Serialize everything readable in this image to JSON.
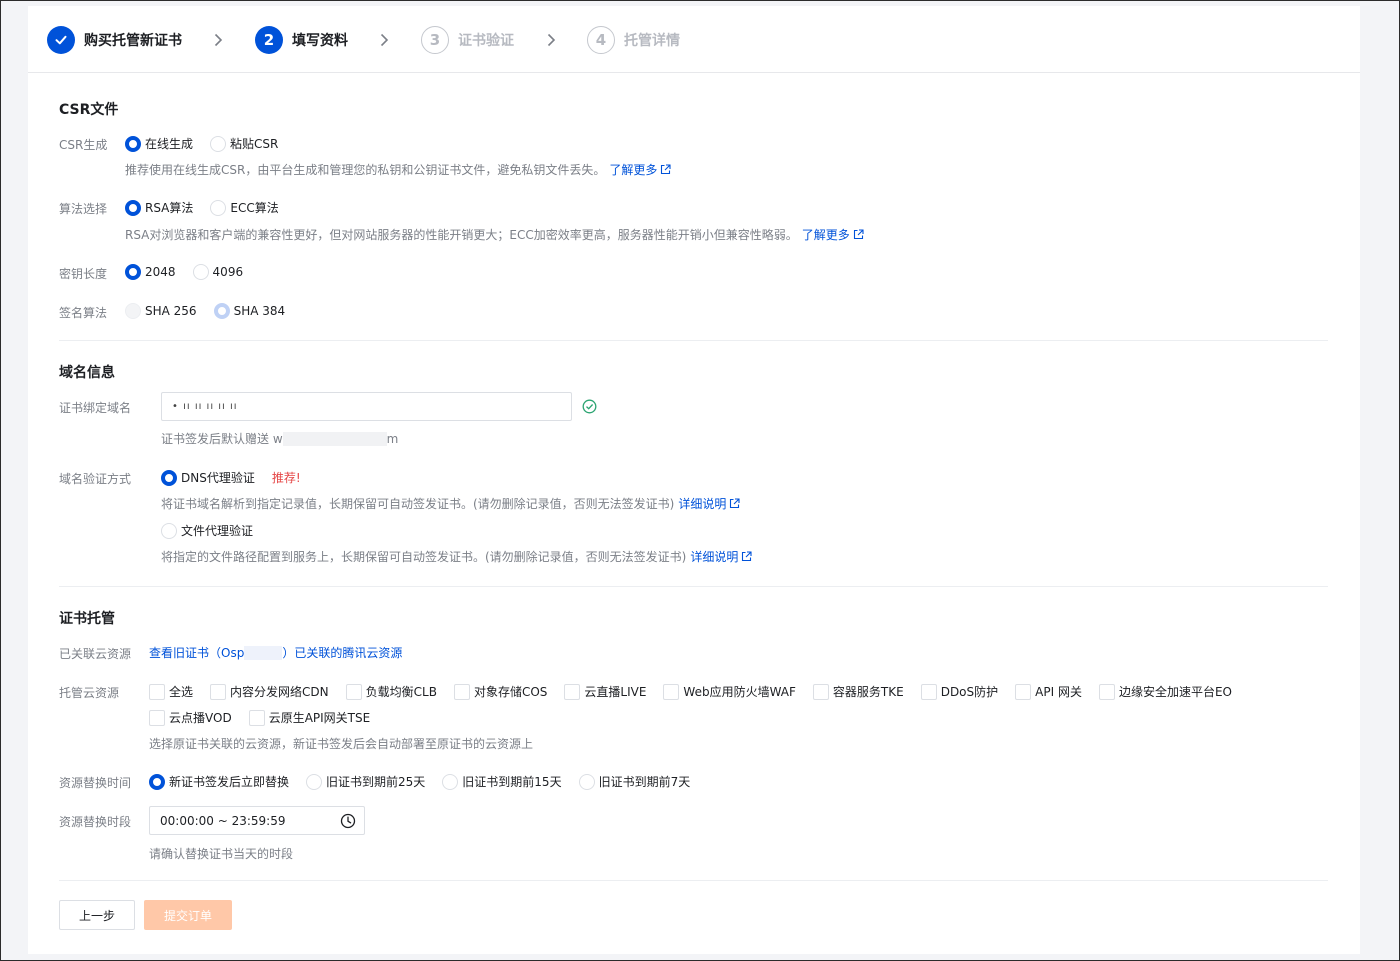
{
  "steps": [
    {
      "num": "✓",
      "label": "购买托管新证书",
      "state": "done"
    },
    {
      "num": "2",
      "label": "填写资料",
      "state": "active"
    },
    {
      "num": "3",
      "label": "证书验证",
      "state": "todo"
    },
    {
      "num": "4",
      "label": "托管详情",
      "state": "todo"
    }
  ],
  "csr": {
    "title": "CSR文件",
    "gen_label": "CSR生成",
    "gen_options": [
      "在线生成",
      "粘贴CSR"
    ],
    "gen_hint": "推荐使用在线生成CSR，由平台生成和管理您的私钥和公钥证书文件，避免私钥文件丢失。",
    "learn_more": "了解更多",
    "algo_label": "算法选择",
    "algo_options": [
      "RSA算法",
      "ECC算法"
    ],
    "algo_hint": "RSA对浏览器和客户端的兼容性更好，但对网站服务器的性能开销更大；ECC加密效率更高，服务器性能开销小但兼容性略弱。",
    "keylen_label": "密钥长度",
    "keylen_options": [
      "2048",
      "4096"
    ],
    "sig_label": "签名算法",
    "sig_options": [
      "SHA 256",
      "SHA 384"
    ]
  },
  "domain": {
    "title": "域名信息",
    "bind_label": "证书绑定域名",
    "bind_value": "• ıı ıı ıı ıı ıı",
    "gift_prefix": "证书签发后默认赠送 w",
    "gift_suffix": "m",
    "verify_label": "域名验证方式",
    "dns_option": "DNS代理验证",
    "recommend": "推荐!",
    "dns_hint": "将证书域名解析到指定记录值，长期保留可自动签发证书。(请勿删除记录值，否则无法签发证书)",
    "detail": "详细说明",
    "file_option": "文件代理验证",
    "file_hint": "将指定的文件路径配置到服务上，长期保留可自动签发证书。(请勿删除记录值，否则无法签发证书)"
  },
  "hosting": {
    "title": "证书托管",
    "linked_label": "已关联云资源",
    "linked_link_prefix": "查看旧证书（Osp",
    "linked_link_suffix": "）已关联的腾讯云资源",
    "res_label": "托管云资源",
    "res_row1": [
      "全选",
      "内容分发网络CDN",
      "负载均衡CLB",
      "对象存储COS",
      "云直播LIVE",
      "Web应用防火墙WAF",
      "容器服务TKE",
      "DDoS防护",
      "API 网关",
      "边缘安全加速平台EO"
    ],
    "res_row2": [
      "云点播VOD",
      "云原生API网关TSE"
    ],
    "res_hint": "选择原证书关联的云资源，新证书签发后会自动部署至原证书的云资源上",
    "time_label": "资源替换时间",
    "time_options": [
      "新证书签发后立即替换",
      "旧证书到期前25天",
      "旧证书到期前15天",
      "旧证书到期前7天"
    ],
    "period_label": "资源替换时段",
    "period_value": "00:00:00 ~ 23:59:59",
    "period_hint": "请确认替换证书当天的时段"
  },
  "footer": {
    "prev": "上一步",
    "submit": "提交订单"
  },
  "colors": {
    "primary": "#0052d9",
    "success": "#2ba471",
    "danger": "#e54545",
    "submit_disabled": "#ffc8a8"
  }
}
